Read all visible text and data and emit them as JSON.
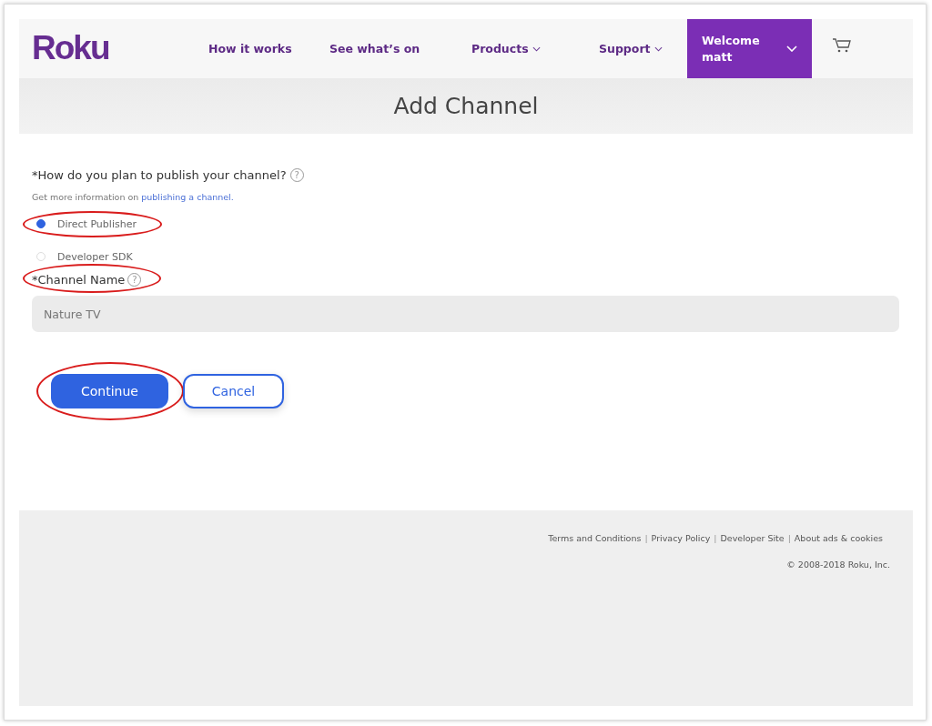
{
  "header": {
    "logo": "Roku",
    "nav": [
      {
        "label": "How it works",
        "dropdown": false
      },
      {
        "label": "See what’s on",
        "dropdown": false
      },
      {
        "label": "Products",
        "dropdown": true
      },
      {
        "label": "Support",
        "dropdown": true
      }
    ],
    "account": {
      "line1": "Welcome",
      "line2": "matt"
    }
  },
  "page_title": "Add Channel",
  "form": {
    "question": "*How do you plan to publish your channel?",
    "question_help": "?",
    "name_help": "?",
    "info_text": "Get more information on",
    "info_link": "publishing a channel.",
    "options": [
      {
        "label": "Direct Publisher",
        "selected": true,
        "annotated": true
      },
      {
        "label": "Developer SDK",
        "selected": false,
        "annotated": false
      }
    ],
    "name_label": "*Channel Name",
    "name_label_annotated": true,
    "name_value": "Nature TV",
    "buttons": [
      {
        "label": "Continue",
        "kind": "primary",
        "annotated": true
      },
      {
        "label": "Cancel",
        "kind": "secondary",
        "annotated": false
      }
    ]
  },
  "footer": {
    "links": [
      "Terms and Conditions",
      "Privacy Policy",
      "Developer Site",
      "About ads & cookies"
    ],
    "separator": "|",
    "copyright": "© 2008-2018 Roku, Inc."
  }
}
